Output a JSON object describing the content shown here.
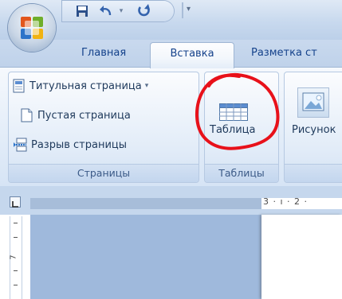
{
  "tabs": [
    {
      "label": "Главная"
    },
    {
      "label": "Вставка"
    },
    {
      "label": "Разметка ст"
    }
  ],
  "groups": {
    "pages": {
      "label": "Страницы",
      "commands": [
        "Титульная страница",
        "Пустая страница",
        "Разрыв страницы"
      ]
    },
    "tables": {
      "label": "Таблицы",
      "table_button": "Таблица"
    },
    "illustrations": {
      "picture_button": "Рисунок"
    }
  },
  "ruler": {
    "horizontal_text": "3 · ı · 2 ·",
    "vertical_digit": "7"
  },
  "colors": {
    "ribbon_text": "#1e395b",
    "tab_text": "#15428b",
    "annotation": "#e8111a"
  },
  "icons": [
    "office-button-icon",
    "save-icon",
    "undo-icon",
    "redo-icon",
    "cover-page-icon",
    "blank-page-icon",
    "page-break-icon",
    "table-icon",
    "picture-icon"
  ]
}
